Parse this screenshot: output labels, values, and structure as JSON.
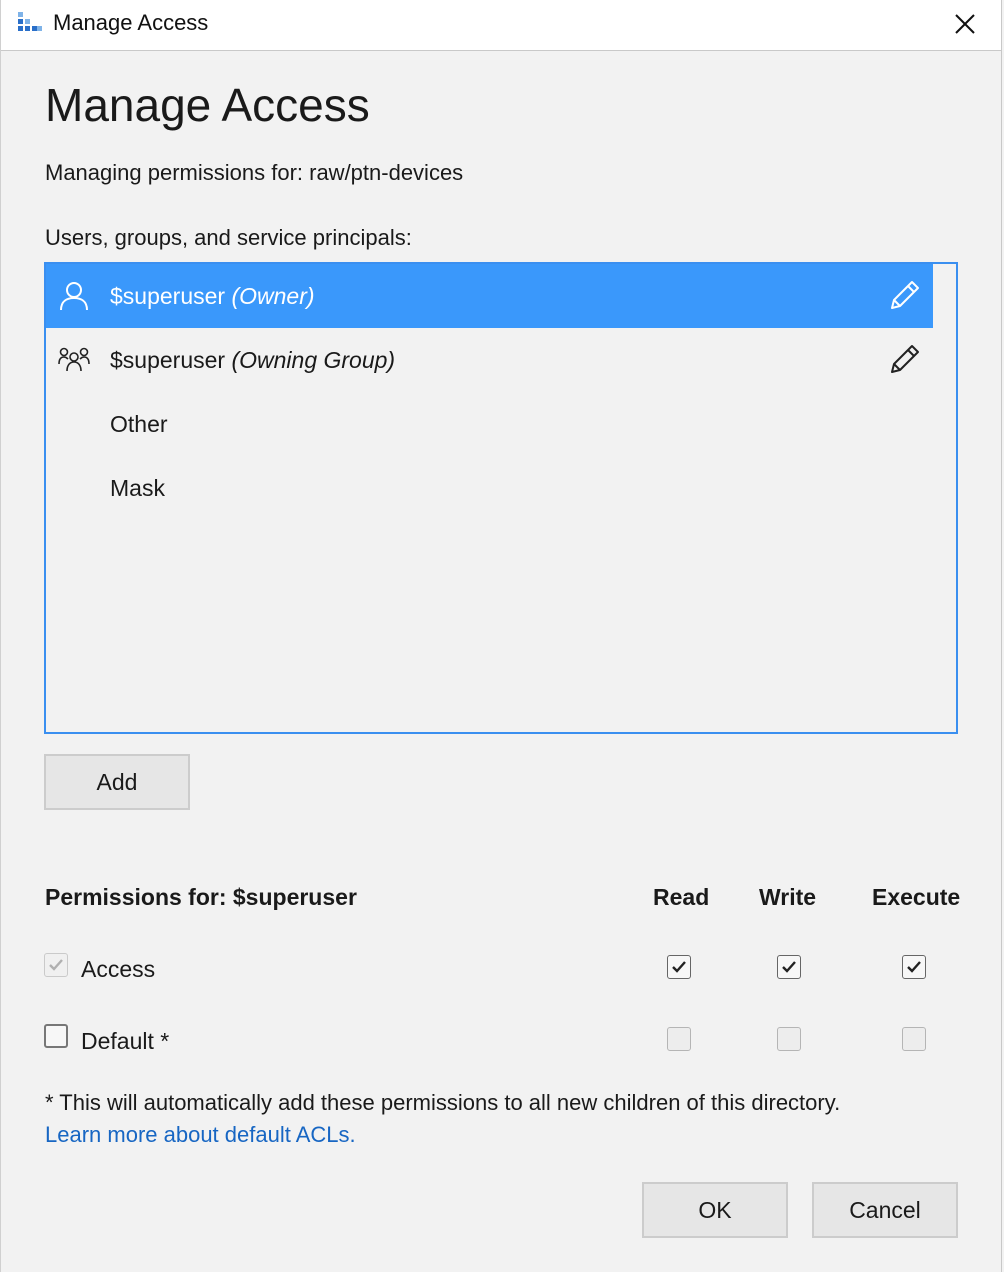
{
  "window": {
    "title": "Manage Access"
  },
  "dialog": {
    "heading": "Manage Access",
    "managing_for": "Managing permissions for: raw/ptn-devices",
    "list_label": "Users, groups, and service principals:",
    "principals": [
      {
        "name": "$superuser",
        "role": "(Owner)",
        "icon": "user-icon",
        "editable": true,
        "selected": true
      },
      {
        "name": "$superuser",
        "role": "(Owning Group)",
        "icon": "group-icon",
        "editable": true,
        "selected": false
      },
      {
        "name": "Other",
        "role": "",
        "icon": "",
        "editable": false,
        "selected": false
      },
      {
        "name": "Mask",
        "role": "",
        "icon": "",
        "editable": false,
        "selected": false
      }
    ],
    "add_button": "Add",
    "permissions": {
      "title": "Permissions for: $superuser",
      "columns": [
        "Read",
        "Write",
        "Execute"
      ],
      "rows": [
        {
          "label": "Access",
          "enabled": true,
          "values": [
            true,
            true,
            true
          ]
        },
        {
          "label": "Default *",
          "enabled": false,
          "values": [
            false,
            false,
            false
          ]
        }
      ]
    },
    "footnote": "* This will automatically add these permissions to all new children of this directory.",
    "learn_more_link": "Learn more about default ACLs.",
    "ok_button": "OK",
    "cancel_button": "Cancel"
  },
  "colors": {
    "selection": "#3a98fb",
    "list_border": "#3a8ff0",
    "link": "#1766c3"
  }
}
